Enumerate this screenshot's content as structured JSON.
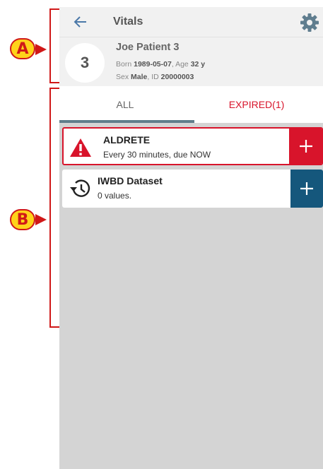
{
  "header": {
    "title": "Vitals",
    "back_icon": "arrow-left-icon",
    "settings_icon": "gear-icon"
  },
  "patient": {
    "bed": "3",
    "name": "Joe Patient 3",
    "born_label": "Born",
    "born": "1989-05-07",
    "age_label": "Age",
    "age": "32 y",
    "sex_label": "Sex",
    "sex": "Male",
    "id_label": "ID",
    "id": "20000003"
  },
  "tabs": [
    {
      "label": "ALL",
      "active": true
    },
    {
      "label": "EXPIRED(1)",
      "active": false
    }
  ],
  "cards": [
    {
      "title": "ALDRETE",
      "subtitle": "Every 30 minutes, due NOW",
      "icon": "warning-icon",
      "status": "expired"
    },
    {
      "title": "IWBD Dataset",
      "subtitle": "0 values.",
      "icon": "history-icon",
      "status": "normal"
    }
  ],
  "callouts": {
    "a": "A",
    "b": "B"
  },
  "colors": {
    "accent_red": "#d8142b",
    "accent_blue": "#15577c",
    "tab_underline": "#607d8b",
    "callout_yellow": "#ffd21a"
  }
}
